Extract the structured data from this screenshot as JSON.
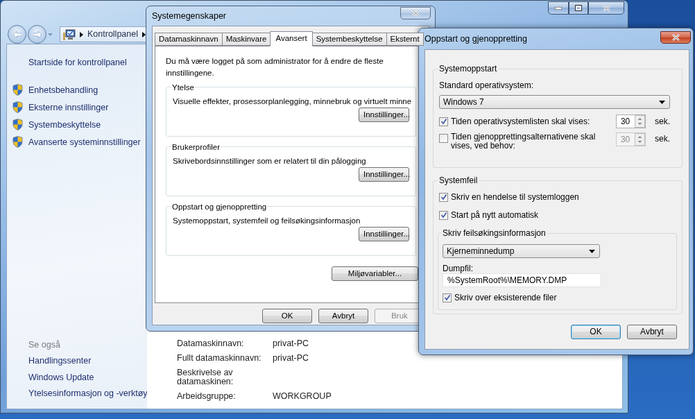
{
  "explorer": {
    "address": [
      {
        "label": "Kontrollpanel"
      }
    ],
    "sidebar": {
      "home": "Startside for kontrollpanel",
      "tasks": [
        {
          "label": "Enhetsbehandling"
        },
        {
          "label": "Eksterne innstillinger"
        },
        {
          "label": "Systembeskyttelse"
        },
        {
          "label": "Avanserte systeminnstillinger"
        }
      ],
      "see_also_title": "Se også",
      "see_also": [
        {
          "label": "Handlingssenter"
        },
        {
          "label": "Windows Update"
        },
        {
          "label": "Ytelsesinformasjon og -verktøy"
        }
      ]
    },
    "info_rows": [
      {
        "label": "Datamaskinnavn:",
        "value": "privat-PC"
      },
      {
        "label": "Fullt datamaskinnavn:",
        "value": "privat-PC"
      },
      {
        "label": "Beskrivelse av datamaskinen:"
      },
      {
        "label": "Arbeidsgruppe:",
        "value": "WORKGROUP"
      }
    ]
  },
  "system_properties": {
    "title": "Systemegenskaper",
    "tabs": [
      {
        "label": "Datamaskinnavn",
        "selected": false
      },
      {
        "label": "Maskinvare",
        "selected": false
      },
      {
        "label": "Avansert",
        "selected": true
      },
      {
        "label": "Systembeskyttelse",
        "selected": false
      },
      {
        "label": "Eksternt",
        "selected": false
      }
    ],
    "notice": "Du må være logget på som administrator for å endre de fleste innstillingene.",
    "groups": [
      {
        "title": "Ytelse",
        "description": "Visuelle effekter, prosessorplanlegging, minnebruk og virtuelt minne",
        "button": "Innstillinger..."
      },
      {
        "title": "Brukerprofiler",
        "description": "Skrivebordsinnstillinger som er relatert til din pålogging",
        "button": "Innstillinger..."
      },
      {
        "title": "Oppstart og gjenoppretting",
        "description": "Systemoppstart, systemfeil og feilsøkingsinformasjon",
        "button": "Innstillinger..."
      }
    ],
    "env_button": "Miljøvariabler...",
    "buttons": [
      {
        "label": "OK",
        "disabled": false
      },
      {
        "label": "Avbryt",
        "disabled": false
      },
      {
        "label": "Bruk",
        "disabled": true
      }
    ]
  },
  "startup_dialog": {
    "title": "Oppstart og gjenoppretting",
    "startup": {
      "title": "Systemoppstart",
      "os_label": "Standard operativsystem:",
      "os_value": "Windows 7",
      "options": [
        {
          "label": "Tiden operativsystemlisten skal vises:",
          "checked": true,
          "value": "30",
          "unit": "sek."
        },
        {
          "label": "Tiden gjenopprettingsalternativene skal vises, ved behov:",
          "checked": false,
          "value": "30",
          "unit": "sek."
        }
      ]
    },
    "failure": {
      "title": "Systemfeil",
      "options": [
        {
          "label": "Skriv en hendelse til systemloggen",
          "checked": true
        },
        {
          "label": "Start på nytt automatisk",
          "checked": true
        }
      ],
      "debug": {
        "title": "Skriv feilsøkingsinformasjon",
        "type": "Kjerneminnedump",
        "dump_label": "Dumpfil:",
        "dump_path": "%SystemRoot%\\MEMORY.DMP",
        "overwrite": {
          "label": "Skriv over eksisterende filer",
          "checked": true
        }
      }
    },
    "buttons": [
      {
        "label": "OK",
        "default": true
      },
      {
        "label": "Avbryt",
        "default": false
      }
    ]
  }
}
